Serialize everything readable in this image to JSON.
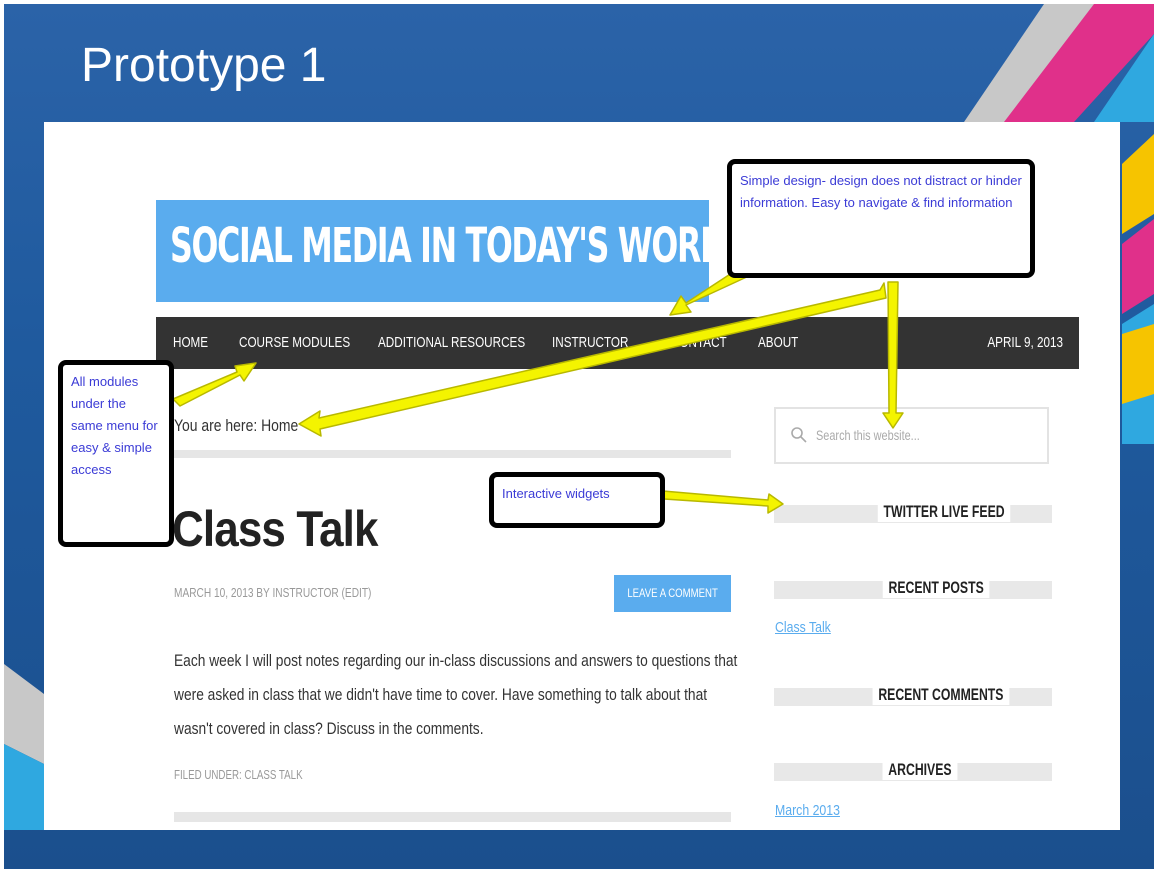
{
  "slide": {
    "title": "Prototype 1",
    "colors": {
      "background": "#1f5a9e",
      "accent_blue": "#5aacee",
      "nav_bg": "#333333",
      "arrow": "#f4f400",
      "note_text": "#3b3bd6"
    }
  },
  "site": {
    "banner_title": "SOCIAL MEDIA IN TODAY'S WORLD",
    "nav": {
      "items": [
        "HOME",
        "COURSE MODULES",
        "ADDITIONAL RESOURCES",
        "INSTRUCTOR",
        "CONTACT",
        "ABOUT"
      ],
      "date": "APRIL 9, 2013"
    },
    "breadcrumb": "You are here: Home",
    "post": {
      "title": "Class Talk",
      "meta": "MARCH 10, 2013 BY INSTRUCTOR (EDIT)",
      "button": "LEAVE A COMMENT",
      "body": "Each week I will post notes regarding our in-class discussions and answers to questions that were asked in class that we didn't have time to cover. Have something to talk about that wasn't covered in class? Discuss in the comments.",
      "filed": "FILED UNDER: CLASS TALK"
    },
    "sidebar": {
      "search_placeholder": "Search this website...",
      "twitter_title": "TWITTER LIVE FEED",
      "recent_posts_title": "RECENT POSTS",
      "recent_post_link": "Class Talk",
      "recent_comments_title": "RECENT COMMENTS",
      "archives_title": "ARCHIVES",
      "archive_link": "March 2013"
    }
  },
  "notes": {
    "simple_design": "Simple design- design does not distract or hinder information. Easy to navigate & find information",
    "modules": "All modules under the same menu for easy & simple access",
    "widgets": "Interactive widgets"
  }
}
